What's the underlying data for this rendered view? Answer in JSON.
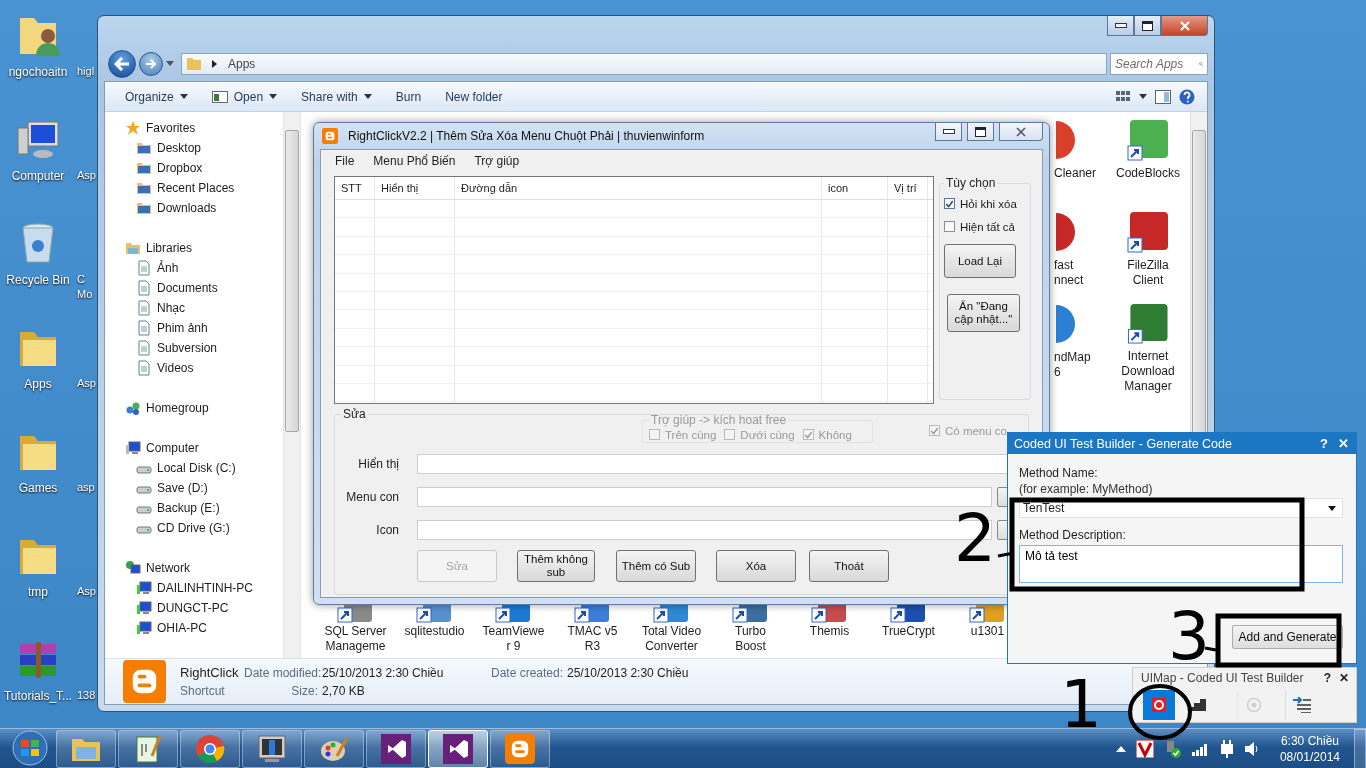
{
  "desktop": {
    "icons": [
      {
        "label": "ngochoaitn",
        "kind": "user-folder"
      },
      {
        "label": "Computer",
        "kind": "computer"
      },
      {
        "label": "Recycle Bin",
        "kind": "recycle-bin"
      },
      {
        "label": "Apps",
        "kind": "folder"
      },
      {
        "label": "Games",
        "kind": "folder"
      },
      {
        "label": "tmp",
        "kind": "folder"
      },
      {
        "label": "Tutorials_T...",
        "kind": "archive"
      }
    ],
    "partial_icons": [
      {
        "lines": [
          "higl"
        ]
      },
      {
        "lines": [
          "Asp"
        ]
      },
      {
        "lines": [
          "C",
          "Mo"
        ]
      },
      {
        "lines": [
          "Asp"
        ]
      },
      {
        "lines": [
          "asp"
        ]
      },
      {
        "lines": [
          "Asp"
        ]
      },
      {
        "lines": [
          "138"
        ]
      }
    ]
  },
  "explorer": {
    "address": "Apps",
    "search": {
      "placeholder": "Search Apps"
    },
    "toolbar": [
      {
        "label": "Organize",
        "dropdown": true,
        "kind": "text"
      },
      {
        "label": "Open",
        "dropdown": true,
        "kind": "open"
      },
      {
        "label": "Share with",
        "dropdown": true,
        "kind": "text"
      },
      {
        "label": "Burn",
        "dropdown": false,
        "kind": "text"
      },
      {
        "label": "New folder",
        "dropdown": false,
        "kind": "text"
      }
    ],
    "nav": [
      {
        "label": "Favorites",
        "kind": "favorites",
        "children": [
          {
            "label": "Desktop"
          },
          {
            "label": "Dropbox"
          },
          {
            "label": "Recent Places"
          },
          {
            "label": "Downloads"
          }
        ]
      },
      {
        "label": "Libraries",
        "kind": "libraries",
        "children": [
          {
            "label": "Ảnh"
          },
          {
            "label": "Documents"
          },
          {
            "label": "Nhạc"
          },
          {
            "label": "Phim ảnh"
          },
          {
            "label": "Subversion"
          },
          {
            "label": "Videos"
          }
        ]
      },
      {
        "label": "Homegroup",
        "kind": "homegroup"
      },
      {
        "label": "Computer",
        "kind": "computer",
        "children": [
          {
            "label": "Local Disk (C:)"
          },
          {
            "label": "Save (D:)"
          },
          {
            "label": "Backup (E:)"
          },
          {
            "label": "CD Drive (G:)"
          }
        ]
      },
      {
        "label": "Network",
        "kind": "network",
        "children": [
          {
            "label": "DAILINHTINH-PC"
          },
          {
            "label": "DUNGCT-PC"
          },
          {
            "label": "OHIA-PC"
          }
        ]
      }
    ],
    "items_column_1": [
      {
        "lines": [
          "Cleaner"
        ]
      },
      {
        "lines": [
          "fast",
          "nnect"
        ]
      },
      {
        "lines": [
          "ndMap",
          "6"
        ]
      }
    ],
    "items_column_2": [
      {
        "lines": [
          "CodeBlocks"
        ]
      },
      {
        "lines": [
          "FileZilla",
          "Client"
        ]
      },
      {
        "lines": [
          "Internet",
          "Download",
          "Manager"
        ]
      }
    ],
    "items_bottom": [
      {
        "lines": [
          "SQL Server",
          "Manageme"
        ]
      },
      {
        "lines": [
          "sqlitestudio"
        ]
      },
      {
        "lines": [
          "TeamViewe",
          "r 9"
        ]
      },
      {
        "lines": [
          "TMAC v5",
          "R3"
        ]
      },
      {
        "lines": [
          "Total Video",
          "Converter"
        ]
      },
      {
        "lines": [
          "Turbo",
          "Boost"
        ]
      },
      {
        "lines": [
          "Themis"
        ]
      },
      {
        "lines": [
          "TrueCrypt"
        ]
      },
      {
        "lines": [
          "u1301"
        ]
      }
    ],
    "details": {
      "name": "RightClick",
      "type": "Shortcut",
      "fields": [
        {
          "label": "Date modified:",
          "value": "25/10/2013 2:30 Chiều"
        },
        {
          "label": "Date created:",
          "value": "25/10/2013 2:30 Chiều"
        },
        {
          "label": "Size:",
          "value": "2,70 KB"
        }
      ]
    }
  },
  "rightclick": {
    "title": "RightClickV2.2 | Thêm Sửa Xóa Menu Chuột Phải | thuvienwinform",
    "menu": [
      "File",
      "Menu Phổ Biến",
      "Trợ giúp"
    ],
    "columns": [
      "STT",
      "Hiển thị",
      "Đường dẫn",
      "icon",
      "Vị trí"
    ],
    "options": {
      "legend": "Tùy chọn",
      "checkboxes": [
        {
          "label": "Hỏi khi xóa",
          "checked": true
        },
        {
          "label": "Hiện tất cả",
          "checked": false
        }
      ],
      "buttons": [
        "Load Lại",
        "Ẩn \"Đang cập nhật...\""
      ]
    },
    "edit": {
      "legend": "Sửa",
      "help_group": {
        "legend": "Trợ giúp -> kích hoat free",
        "disabled": true,
        "checkboxes": [
          {
            "label": "Trên cùng",
            "checked": false
          },
          {
            "label": "Dưới cùng",
            "checked": false
          },
          {
            "label": "Không",
            "checked": true
          }
        ]
      },
      "submenu_checkbox": {
        "label": "Có menu co",
        "checked": true,
        "disabled": true
      },
      "fields": [
        {
          "label": "Hiển thị",
          "browse": false
        },
        {
          "label": "Menu con",
          "browse": true
        },
        {
          "label": "Icon",
          "browse": true
        }
      ],
      "buttons": [
        {
          "label": "Sửa",
          "disabled": true
        },
        {
          "label": "Thêm không sub",
          "disabled": false
        },
        {
          "label": "Thêm có Sub",
          "disabled": false
        },
        {
          "label": "Xóa",
          "disabled": false
        },
        {
          "label": "Thoát",
          "disabled": false
        }
      ]
    }
  },
  "generate_dialog": {
    "title": "Coded UI Test Builder - Generate Code",
    "title_buttons": [
      "?",
      "✕"
    ],
    "method_name_label": "Method Name:",
    "hint": "(for example: MyMethod)",
    "method_name": "TenTest",
    "description_label": "Method Description:",
    "description": "Mô tả test",
    "button": "Add and Generate"
  },
  "test_builder": {
    "title": "UIMap - Coded UI Test Builder",
    "title_buttons": [
      "?",
      "✕"
    ],
    "tools": [
      {
        "kind": "record",
        "selected": true,
        "disabled": false
      },
      {
        "kind": "steps",
        "selected": false,
        "disabled": false
      },
      {
        "kind": "target",
        "selected": false,
        "disabled": true
      },
      {
        "kind": "generate",
        "selected": false,
        "disabled": false
      }
    ]
  },
  "taskbar": {
    "apps": [
      {
        "kind": "explorer",
        "selected": false
      },
      {
        "kind": "notepad",
        "selected": false
      },
      {
        "kind": "chrome",
        "selected": false
      },
      {
        "kind": "monitor",
        "selected": false
      },
      {
        "kind": "paint",
        "selected": false
      },
      {
        "kind": "studio",
        "selected": false
      },
      {
        "kind": "studio",
        "selected": true
      },
      {
        "kind": "blogger",
        "selected": false
      }
    ],
    "time": "6:30 Chiều",
    "date": "08/01/2014"
  },
  "annotations": [
    {
      "label": "1"
    },
    {
      "label": "2"
    },
    {
      "label": "3"
    }
  ]
}
